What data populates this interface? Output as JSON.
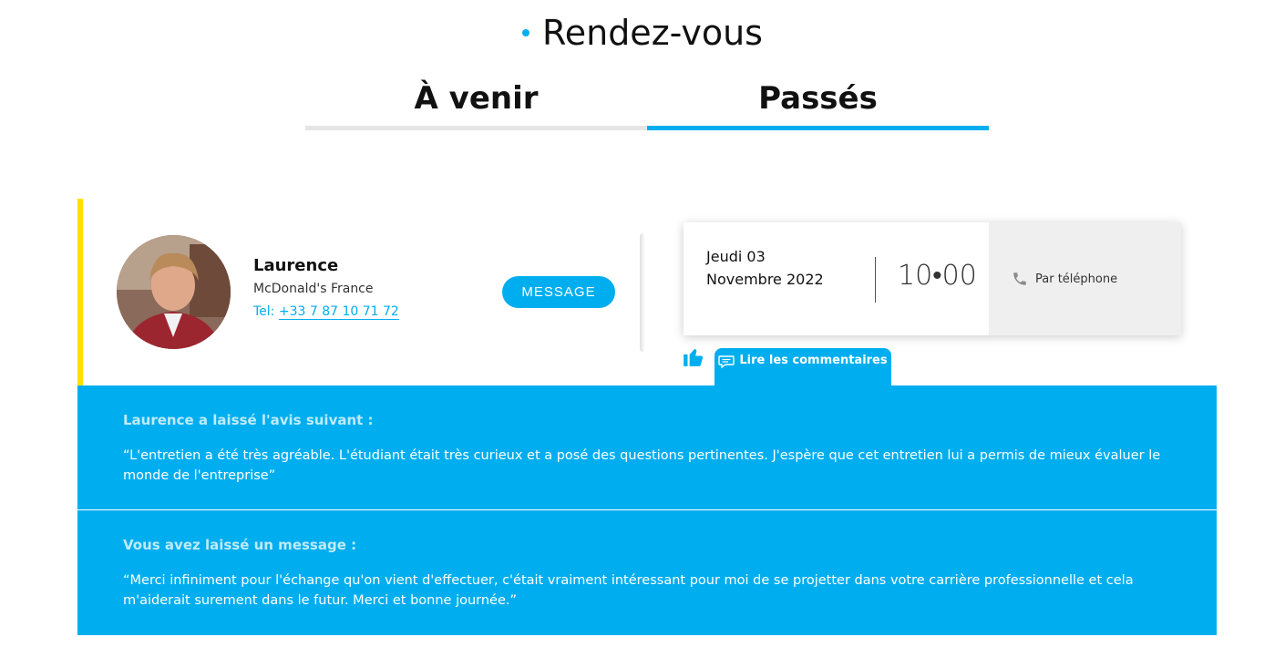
{
  "header": {
    "title": "Rendez-vous"
  },
  "tabs": [
    {
      "label": "À venir",
      "active": false
    },
    {
      "label": "Passés",
      "active": true
    }
  ],
  "appointment": {
    "contact": {
      "name": "Laurence",
      "company": "McDonald's France",
      "tel_prefix": "Tel: ",
      "tel": "+33 7 87 10 71 72"
    },
    "message_button": "MESSAGE",
    "date": "Jeudi 03 Novembre 2022",
    "time": "10•00",
    "mode": "Par téléphone",
    "comments_button": "Lire les commentaires"
  },
  "feedback": {
    "received": {
      "title": "Laurence a laissé l'avis suivant :",
      "text": "“L'entretien a été très agréable. L'étudiant était très curieux et a posé des questions pertinentes. J'espère que cet entretien lui a permis de mieux évaluer le monde de l'entreprise”"
    },
    "sent": {
      "title": "Vous avez laissé un message :",
      "text": "“Merci infiniment pour l'échange qu'on vient d'effectuer, c'était vraiment intéressant pour moi de se projetter dans votre carrière professionnelle et cela m'aiderait surement dans le futur. Merci et bonne journée.”"
    }
  },
  "colors": {
    "accent": "#00aeef",
    "status_bar": "#ffe100",
    "tab_inactive": "#e5e5e5"
  },
  "icons": {
    "thumb": "thumbs-up-icon",
    "comments": "chat-bubble-icon",
    "phone": "phone-icon"
  }
}
